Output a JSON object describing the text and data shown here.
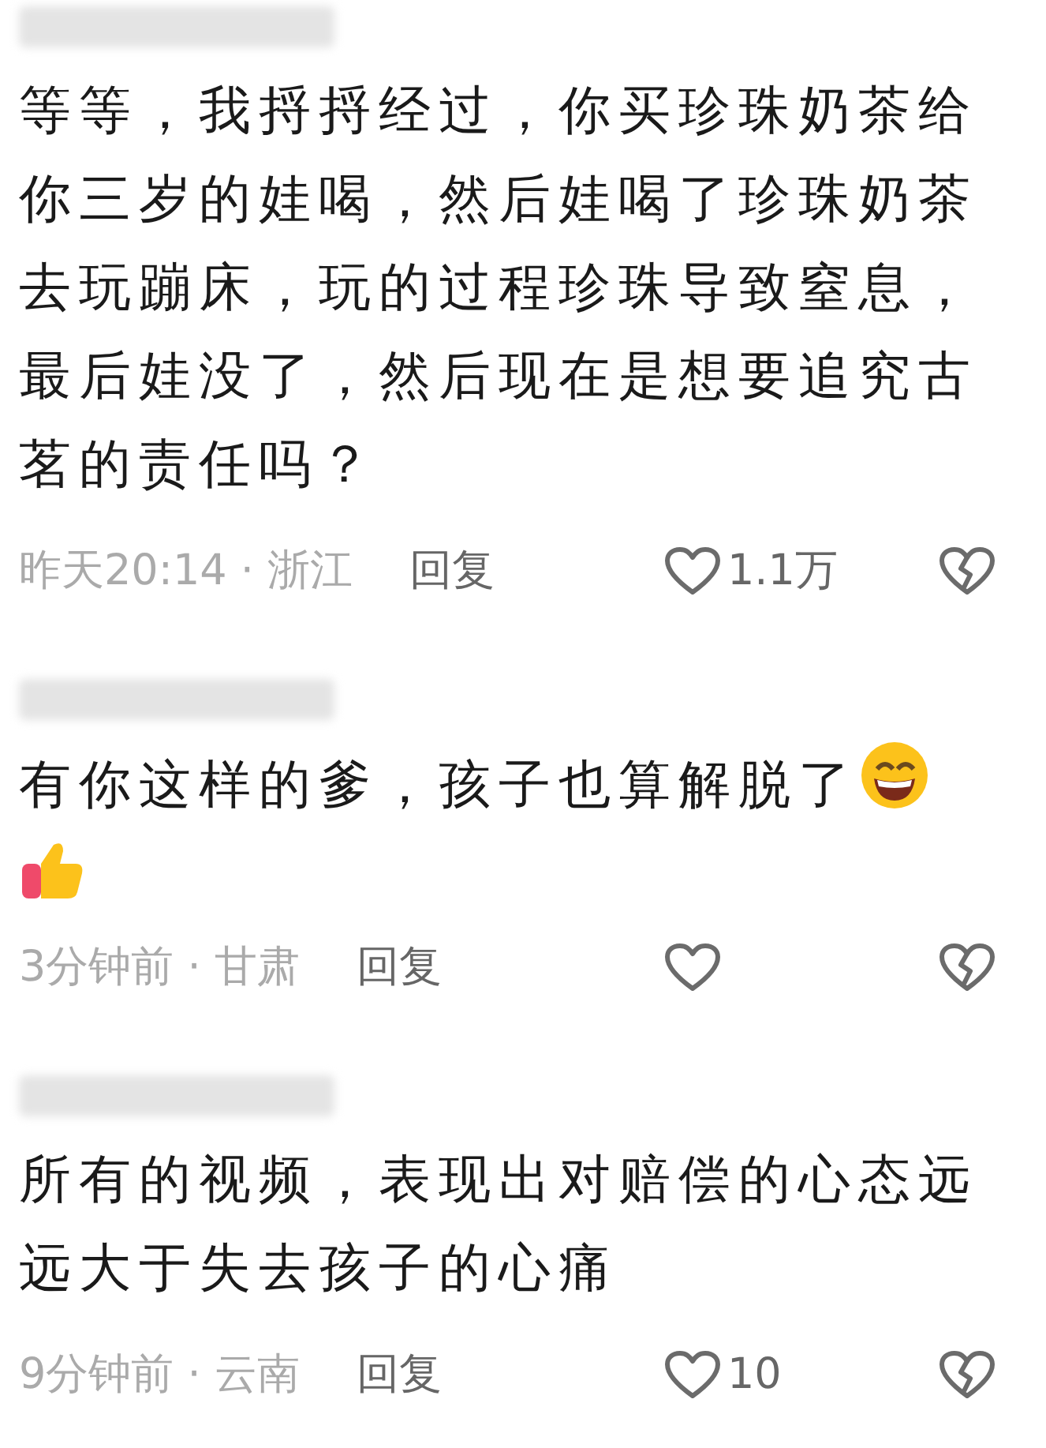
{
  "comments": [
    {
      "text": "等等，我捋捋经过，你买珍珠奶茶给你三岁的娃喝，然后娃喝了珍珠奶茶去玩蹦床，玩的过程珍珠导致窒息，最后娃没了，然后现在是想要追究古茗的责任吗？",
      "time": "昨天20:14",
      "location": "浙江",
      "reply": "回复",
      "likes": "1.1万"
    },
    {
      "text": "有你这样的爹，孩子也算解脱了",
      "trailing_icons": [
        {
          "kind": "grin"
        },
        {
          "kind": "thumbs_up"
        }
      ],
      "time": "3分钟前",
      "location": "甘肃",
      "reply": "回复"
    },
    {
      "text": "所有的视频，表现出对赔偿的心态远远大于失去孩子的心痛",
      "time": "9分钟前",
      "location": "云南",
      "reply": "回复",
      "likes": "10"
    }
  ],
  "separator": "·"
}
